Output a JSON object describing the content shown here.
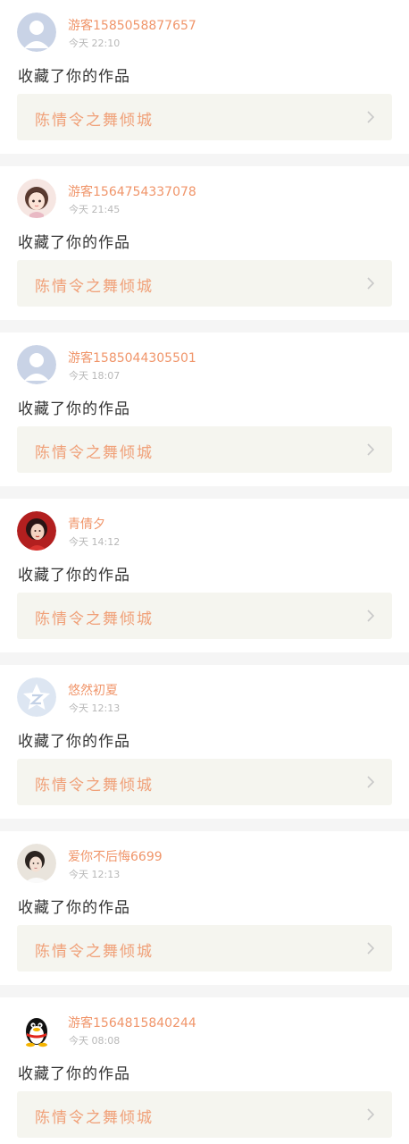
{
  "notifications": [
    {
      "username": "游客1585058877657",
      "time": "今天 22:10",
      "action": "收藏了你的作品",
      "work_title": "陈情令之舞倾城",
      "avatar": "default-avatar"
    },
    {
      "username": "游客1564754337078",
      "time": "今天 21:45",
      "action": "收藏了你的作品",
      "work_title": "陈情令之舞倾城",
      "avatar": "anime-girl-avatar"
    },
    {
      "username": "游客1585044305501",
      "time": "今天 18:07",
      "action": "收藏了你的作品",
      "work_title": "陈情令之舞倾城",
      "avatar": "default-avatar"
    },
    {
      "username": "青倩夕",
      "time": "今天 14:12",
      "action": "收藏了你的作品",
      "work_title": "陈情令之舞倾城",
      "avatar": "photo-avatar-red"
    },
    {
      "username": "悠然初夏",
      "time": "今天 12:13",
      "action": "收藏了你的作品",
      "work_title": "陈情令之舞倾城",
      "avatar": "star-avatar"
    },
    {
      "username": "爱你不后悔6699",
      "time": "今天 12:13",
      "action": "收藏了你的作品",
      "work_title": "陈情令之舞倾城",
      "avatar": "photo-avatar-girl"
    },
    {
      "username": "游客1564815840244",
      "time": "今天 08:08",
      "action": "收藏了你的作品",
      "work_title": "陈情令之舞倾城",
      "avatar": "qq-penguin-avatar"
    }
  ],
  "colors": {
    "username": "#f0956a",
    "time": "#b8b8b8",
    "action": "#333333",
    "work_title": "#f0a078",
    "work_bg": "#f5f5ef",
    "divider": "#f5f5f5"
  }
}
